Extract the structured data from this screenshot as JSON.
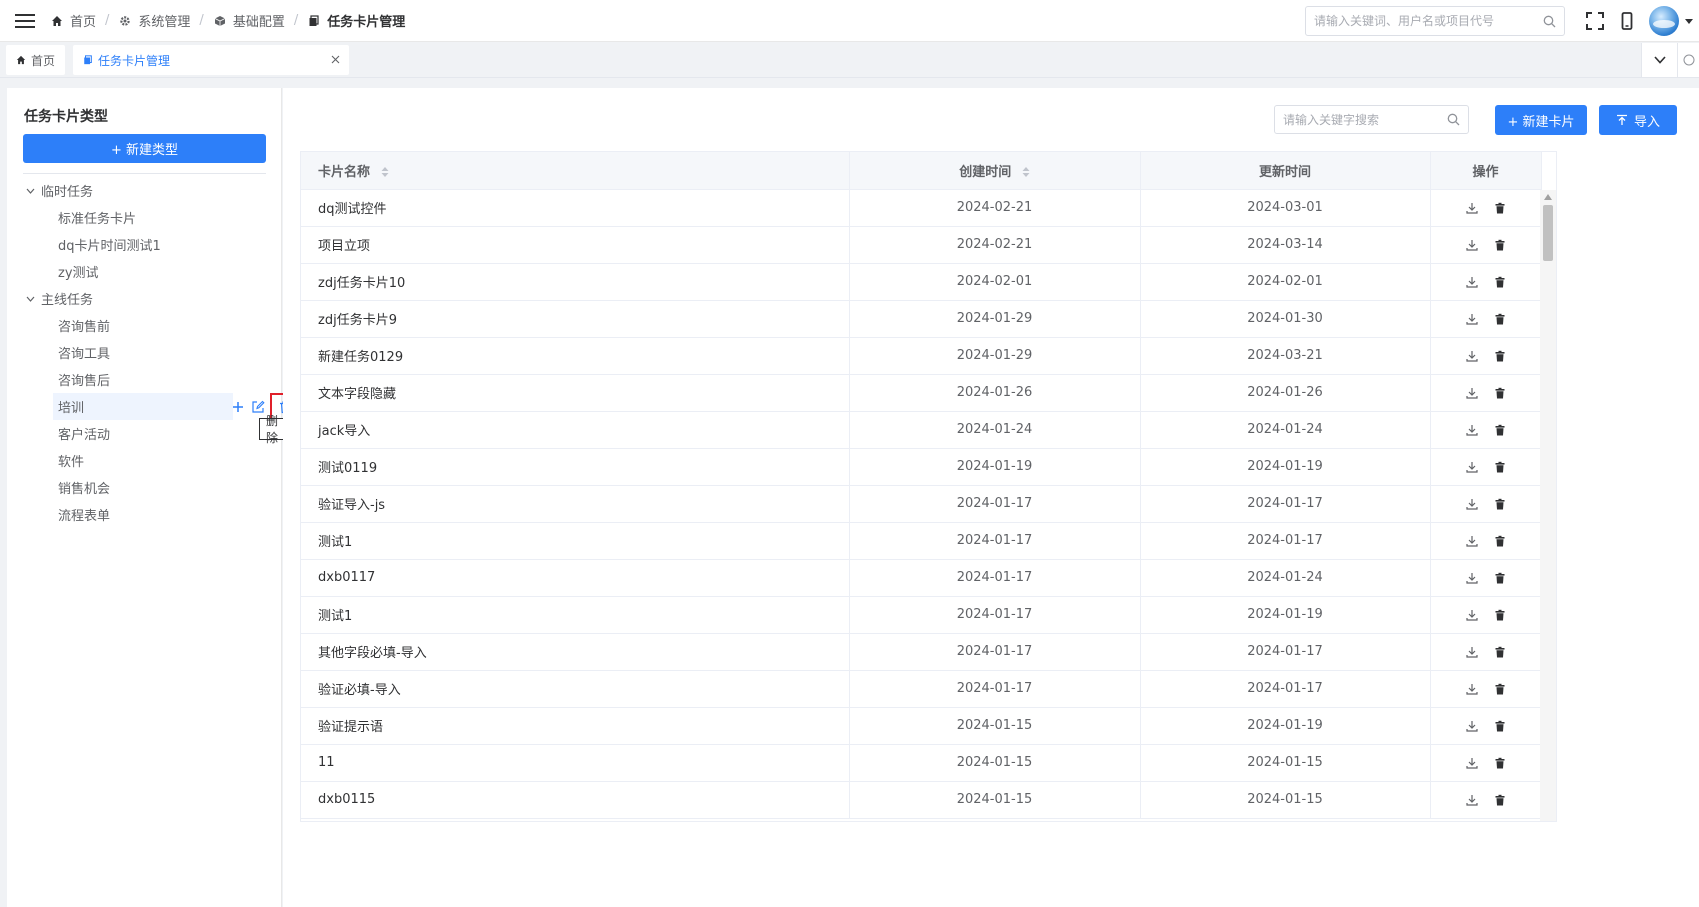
{
  "header": {
    "breadcrumb": [
      {
        "label": "首页",
        "icon": "home-icon"
      },
      {
        "label": "系统管理",
        "icon": "gear-icon"
      },
      {
        "label": "基础配置",
        "icon": "cube-icon"
      },
      {
        "label": "任务卡片管理",
        "icon": "card-icon"
      }
    ],
    "search_placeholder": "请输入关键词、用户名或项目代号"
  },
  "tabs": [
    {
      "label": "首页",
      "active": false
    },
    {
      "label": "任务卡片管理",
      "active": true
    }
  ],
  "left_panel": {
    "title": "任务卡片类型",
    "new_type_label": "+ 新建类型",
    "tree": [
      {
        "group": "临时任务",
        "items": [
          "标准任务卡片",
          "dq卡片时间测试1",
          "zy测试"
        ]
      },
      {
        "group": "主线任务",
        "items": [
          "咨询售前",
          "咨询工具",
          "咨询售后",
          "培训",
          "客户活动",
          "软件",
          "销售机会",
          "流程表单"
        ]
      }
    ],
    "hovered_item": "培训",
    "tooltip": "删除"
  },
  "toolbar": {
    "search_placeholder": "请输入关键字搜索",
    "new_card_label": "+ 新建卡片",
    "import_label": "导入"
  },
  "table": {
    "columns": [
      "卡片名称",
      "创建时间",
      "更新时间",
      "操作"
    ],
    "rows": [
      {
        "name": "dq测试控件",
        "created": "2024-02-21",
        "updated": "2024-03-01"
      },
      {
        "name": "项目立项",
        "created": "2024-02-21",
        "updated": "2024-03-14"
      },
      {
        "name": "zdj任务卡片10",
        "created": "2024-02-01",
        "updated": "2024-02-01"
      },
      {
        "name": "zdj任务卡片9",
        "created": "2024-01-29",
        "updated": "2024-01-30"
      },
      {
        "name": "新建任务0129",
        "created": "2024-01-29",
        "updated": "2024-03-21"
      },
      {
        "name": "文本字段隐藏",
        "created": "2024-01-26",
        "updated": "2024-01-26"
      },
      {
        "name": "jack导入",
        "created": "2024-01-24",
        "updated": "2024-01-24"
      },
      {
        "name": "测试0119",
        "created": "2024-01-19",
        "updated": "2024-01-19"
      },
      {
        "name": "验证导入-js",
        "created": "2024-01-17",
        "updated": "2024-01-17"
      },
      {
        "name": "测试1",
        "created": "2024-01-17",
        "updated": "2024-01-17"
      },
      {
        "name": "dxb0117",
        "created": "2024-01-17",
        "updated": "2024-01-24"
      },
      {
        "name": "测试1",
        "created": "2024-01-17",
        "updated": "2024-01-19"
      },
      {
        "name": "其他字段必填-导入",
        "created": "2024-01-17",
        "updated": "2024-01-17"
      },
      {
        "name": "验证必填-导入",
        "created": "2024-01-17",
        "updated": "2024-01-17"
      },
      {
        "name": "验证提示语",
        "created": "2024-01-15",
        "updated": "2024-01-19"
      },
      {
        "name": "11",
        "created": "2024-01-15",
        "updated": "2024-01-15"
      },
      {
        "name": "dxb0115",
        "created": "2024-01-15",
        "updated": "2024-01-15"
      }
    ]
  },
  "colors": {
    "primary": "#2d7ff9",
    "highlight_border": "#e0202a"
  }
}
